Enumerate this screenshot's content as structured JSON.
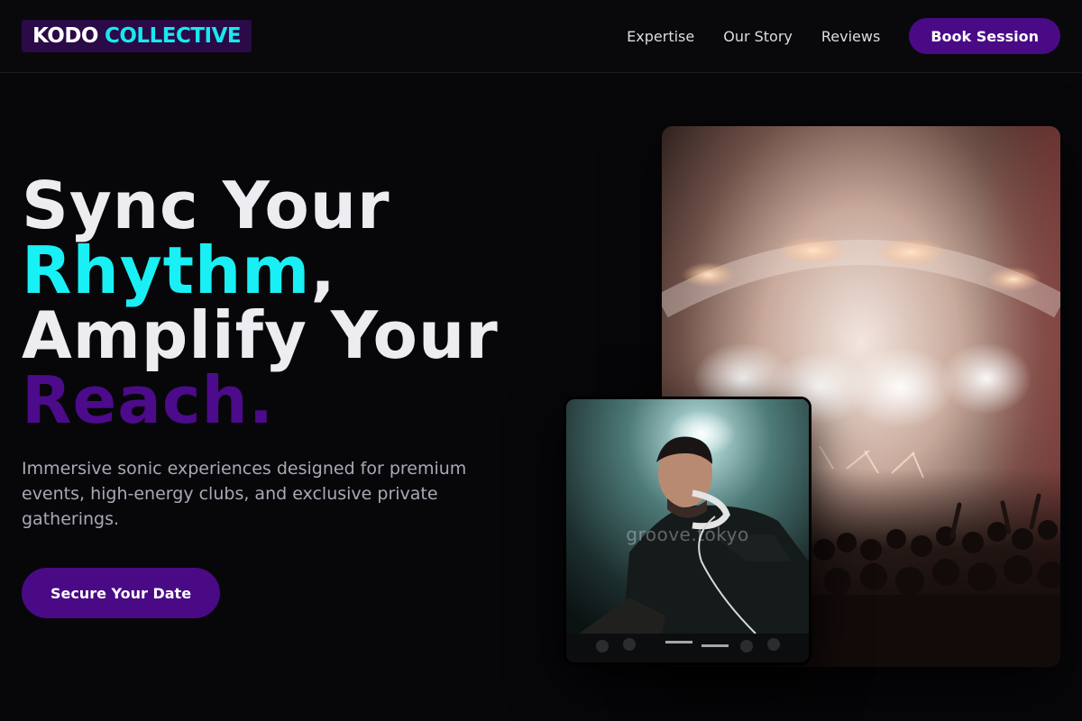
{
  "header": {
    "logo": {
      "word1": "KODO",
      "word2": "COLLECTIVE"
    },
    "nav": [
      "Expertise",
      "Our Story",
      "Reviews"
    ],
    "cta_label": "Book Session"
  },
  "hero": {
    "title_line1": "Sync Your",
    "title_line2_accent": "Rhythm",
    "title_line2_suffix": ",",
    "title_line3": "Amplify Your",
    "title_line4": "Reach.",
    "subtitle": "Immersive sonic experiences designed for premium events, high-energy clubs, and exclusive private gatherings.",
    "cta_label": "Secure Your Date"
  },
  "images": {
    "large": {
      "subject": "concert-crowd-stage-lights"
    },
    "small": {
      "subject": "dj-with-headphones",
      "watermark": "groove.tokyo"
    }
  },
  "colors": {
    "background": "#07070a",
    "accent_cyan": "#19f0f5",
    "accent_purple": "#4a0a86",
    "text_primary": "#ececf1",
    "text_muted": "#a9a9b5"
  }
}
